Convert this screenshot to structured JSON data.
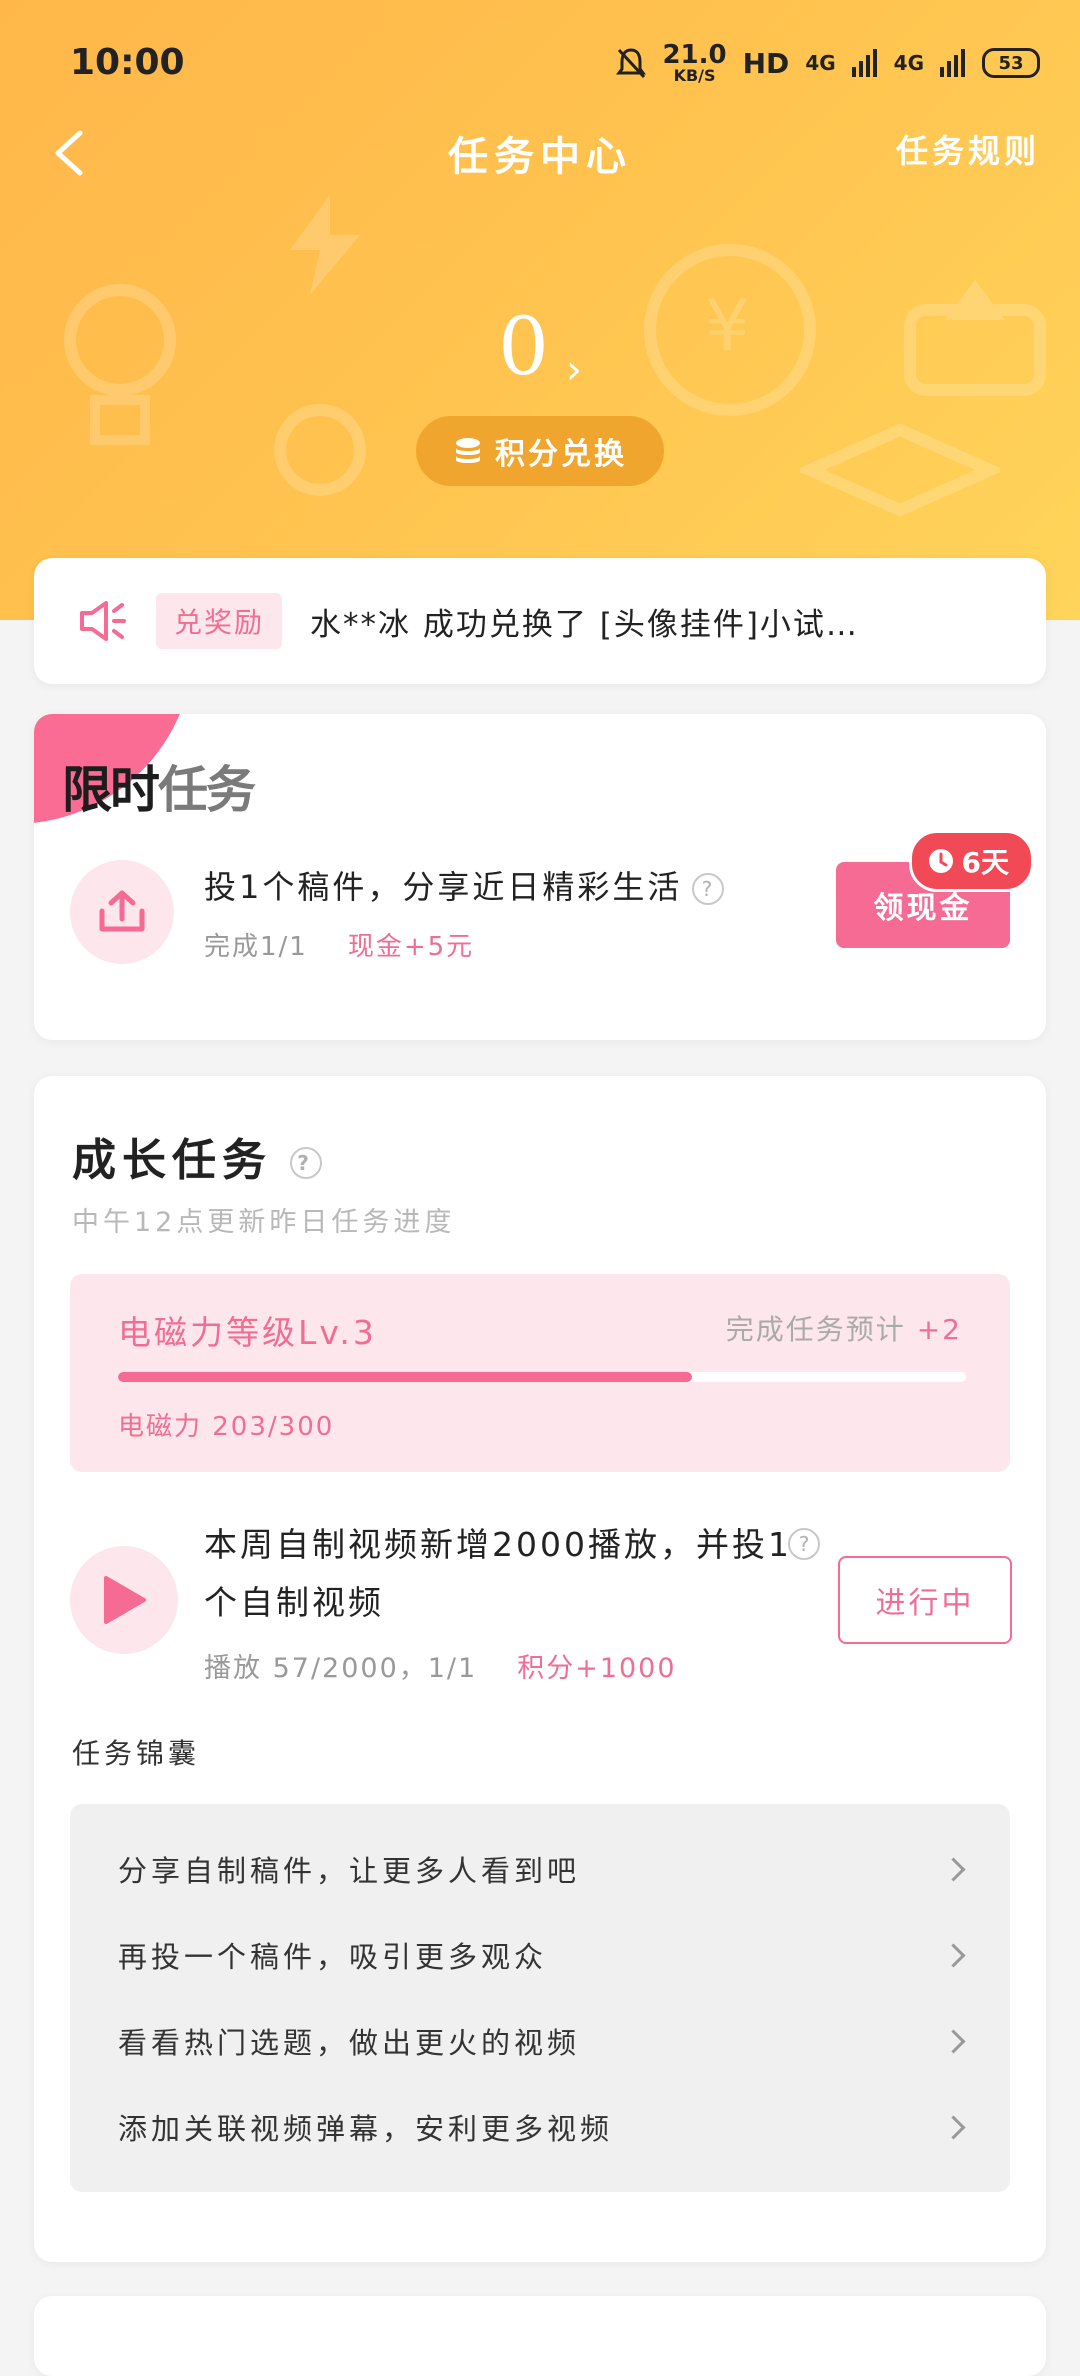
{
  "status_bar": {
    "time": "10:00",
    "speed_num": "21.0",
    "speed_unit": "KB/S",
    "hd": "HD",
    "net1": "4G",
    "net2": "4G",
    "battery": "53"
  },
  "nav": {
    "title": "任务中心",
    "rules": "任务规则"
  },
  "points": {
    "value": "0",
    "exchange_label": "积分兑换"
  },
  "notice": {
    "tag": "兑奖励",
    "message": "水**冰 成功兑换了 [头像挂件]小试…"
  },
  "limited": {
    "title_a": "限时",
    "title_b": "任务",
    "task_title": "投1个稿件，分享近日精彩生活",
    "progress": "完成1/1",
    "reward": "现金+5元",
    "button": "领现金",
    "days": "6天"
  },
  "growth": {
    "title": "成长任务",
    "subtitle": "中午12点更新昨日任务进度",
    "level_label": "电磁力等级Lv.3",
    "estimate_label": "完成任务预计",
    "estimate_value": "+2",
    "level_progress_text": "电磁力 203/300",
    "level_progress_fraction": 0.677,
    "task_title": "本周自制视频新增2000播放，并投1个自制视频",
    "task_progress": "播放 57/2000，1/1",
    "task_reward": "积分+1000",
    "task_button": "进行中",
    "tips_label": "任务锦囊",
    "tips": [
      "分享自制稿件，让更多人看到吧",
      "再投一个稿件，吸引更多观众",
      "看看热门选题，做出更火的视频",
      "添加关联视频弹幕，安利更多视频"
    ]
  },
  "colors": {
    "accent_pink": "#f56b93",
    "hero_orange": "#ffb74a",
    "hero_yellow": "#ffd45a"
  }
}
